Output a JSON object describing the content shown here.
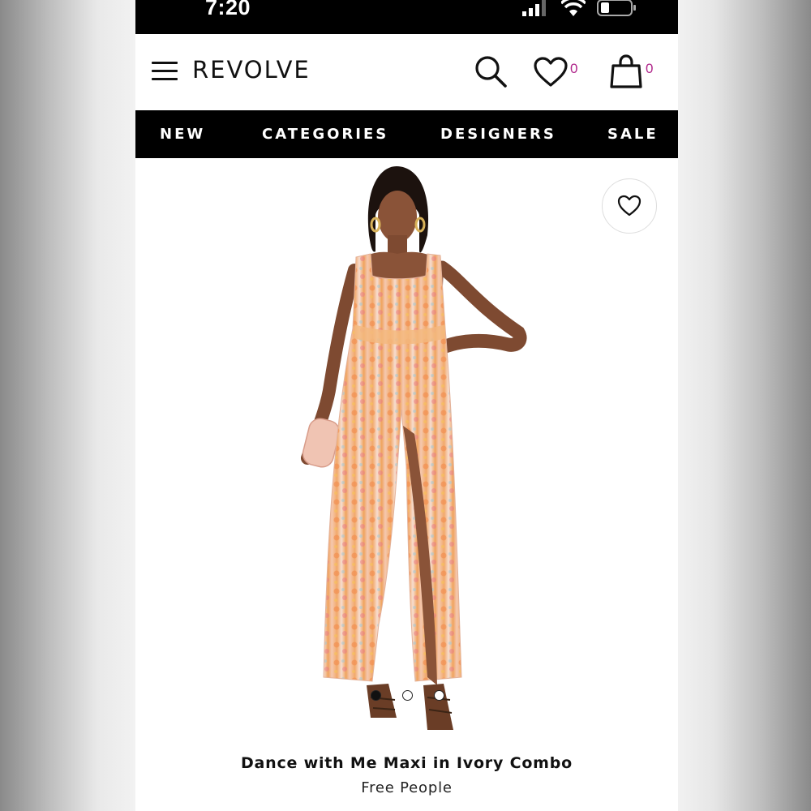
{
  "status_bar": {
    "time": "7:20"
  },
  "header": {
    "logo": "REVOLVE",
    "wishlist_count": "0",
    "bag_count": "0"
  },
  "nav": {
    "items": [
      {
        "label": "NEW"
      },
      {
        "label": "CATEGORIES"
      },
      {
        "label": "DESIGNERS"
      },
      {
        "label": "SALE"
      }
    ]
  },
  "product": {
    "name": "Dance with Me Maxi in Ivory Combo",
    "brand": "Free People",
    "image_count": 3,
    "active_image_index": 0
  },
  "colors": {
    "brand_accent": "#b0268b",
    "nav_background": "#000000"
  }
}
